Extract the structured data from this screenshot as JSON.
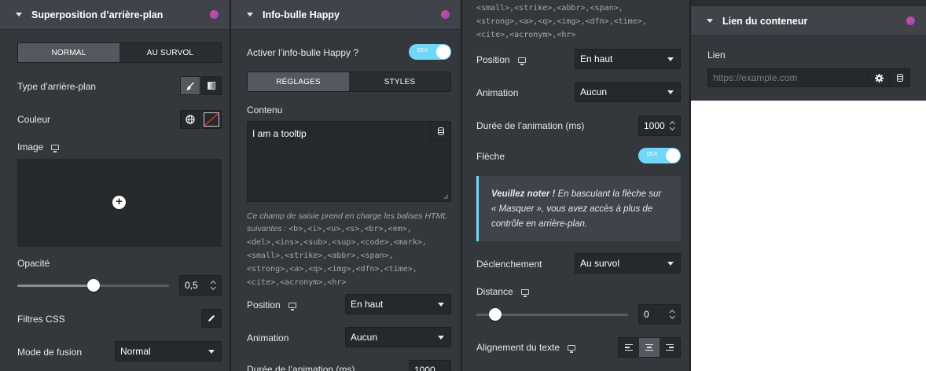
{
  "panel_bg": {
    "header": "Superposition d’arrière-plan",
    "state_tabs": [
      "NORMAL",
      "AU SURVOL"
    ],
    "bg_type_label": "Type d’arrière-plan",
    "bg_type_options": [
      "brush-icon",
      "gradient-icon"
    ],
    "color_label": "Couleur",
    "image_label": "Image",
    "opacity_label": "Opacité",
    "opacity_value": "0,5",
    "opacity_fraction": 0.5,
    "css_filters_label": "Filtres CSS",
    "blend_mode_label": "Mode de fusion",
    "blend_mode_value": "Normal"
  },
  "panel_tooltip": {
    "header": "Info-bulle Happy",
    "enable_label": "Activer l’info-bulle Happy ?",
    "toggle_text": "OUI",
    "tabs": [
      "RÉGLAGES",
      "STYLES"
    ],
    "content_label": "Contenu",
    "content_value": "I am a tooltip",
    "help_intro": "Ce champ de saisie prend en charge les balises HTML suivantes :",
    "help_tags_l1": "<b>,<i>,<u>,<s>,<br>,<em>,",
    "help_tags_l2": "<del>,<ins>,<sub>,<sup>,<code>,<mark>,",
    "help_tags_l3": "<small>,<strike>,<abbr>,<span>,",
    "help_tags_l4": "<strong>,<a>,<q>,<img>,<dfn>,<time>,",
    "help_tags_l5": "<cite>,<acronym>,<hr>",
    "position_label": "Position",
    "position_value": "En haut",
    "animation_label": "Animation",
    "animation_value": "Aucun",
    "duration_label": "Durée de l’animation (ms)",
    "duration_value": "1000"
  },
  "panel_tooltip_cont": {
    "tags_l1": "<small>,<strike>,<abbr>,<span>,",
    "tags_l2": "<strong>,<a>,<q>,<img>,<dfn>,<time>,",
    "tags_l3": "<cite>,<acronym>,<hr>",
    "position_label": "Position",
    "position_value": "En haut",
    "animation_label": "Animation",
    "animation_value": "Aucun",
    "duration_label": "Durée de l’animation (ms)",
    "duration_value": "1000",
    "arrow_label": "Flèche",
    "toggle_text": "OUI",
    "note_bold": "Veuillez noter !",
    "note_l1": " En basculant la flèche sur",
    "note_l2": "« Masquer », vous avez accès à plus de",
    "note_l3": "contrôle en arrière-plan.",
    "trigger_label": "Déclenchement",
    "trigger_value": "Au survol",
    "distance_label": "Distance",
    "distance_value": "0",
    "distance_fraction": 0.0,
    "text_align_label": "Alignement du texte",
    "text_align_selected": "center"
  },
  "panel_link": {
    "header": "Lien du conteneur",
    "link_label": "Lien",
    "link_placeholder": "https://example.com"
  },
  "colors": {
    "panel": "#34383c",
    "header": "#404349",
    "input": "#26292c",
    "accent_toggle": "#71d7f7",
    "logo_start": "#e2498a",
    "logo_end": "#8a4bd1"
  }
}
